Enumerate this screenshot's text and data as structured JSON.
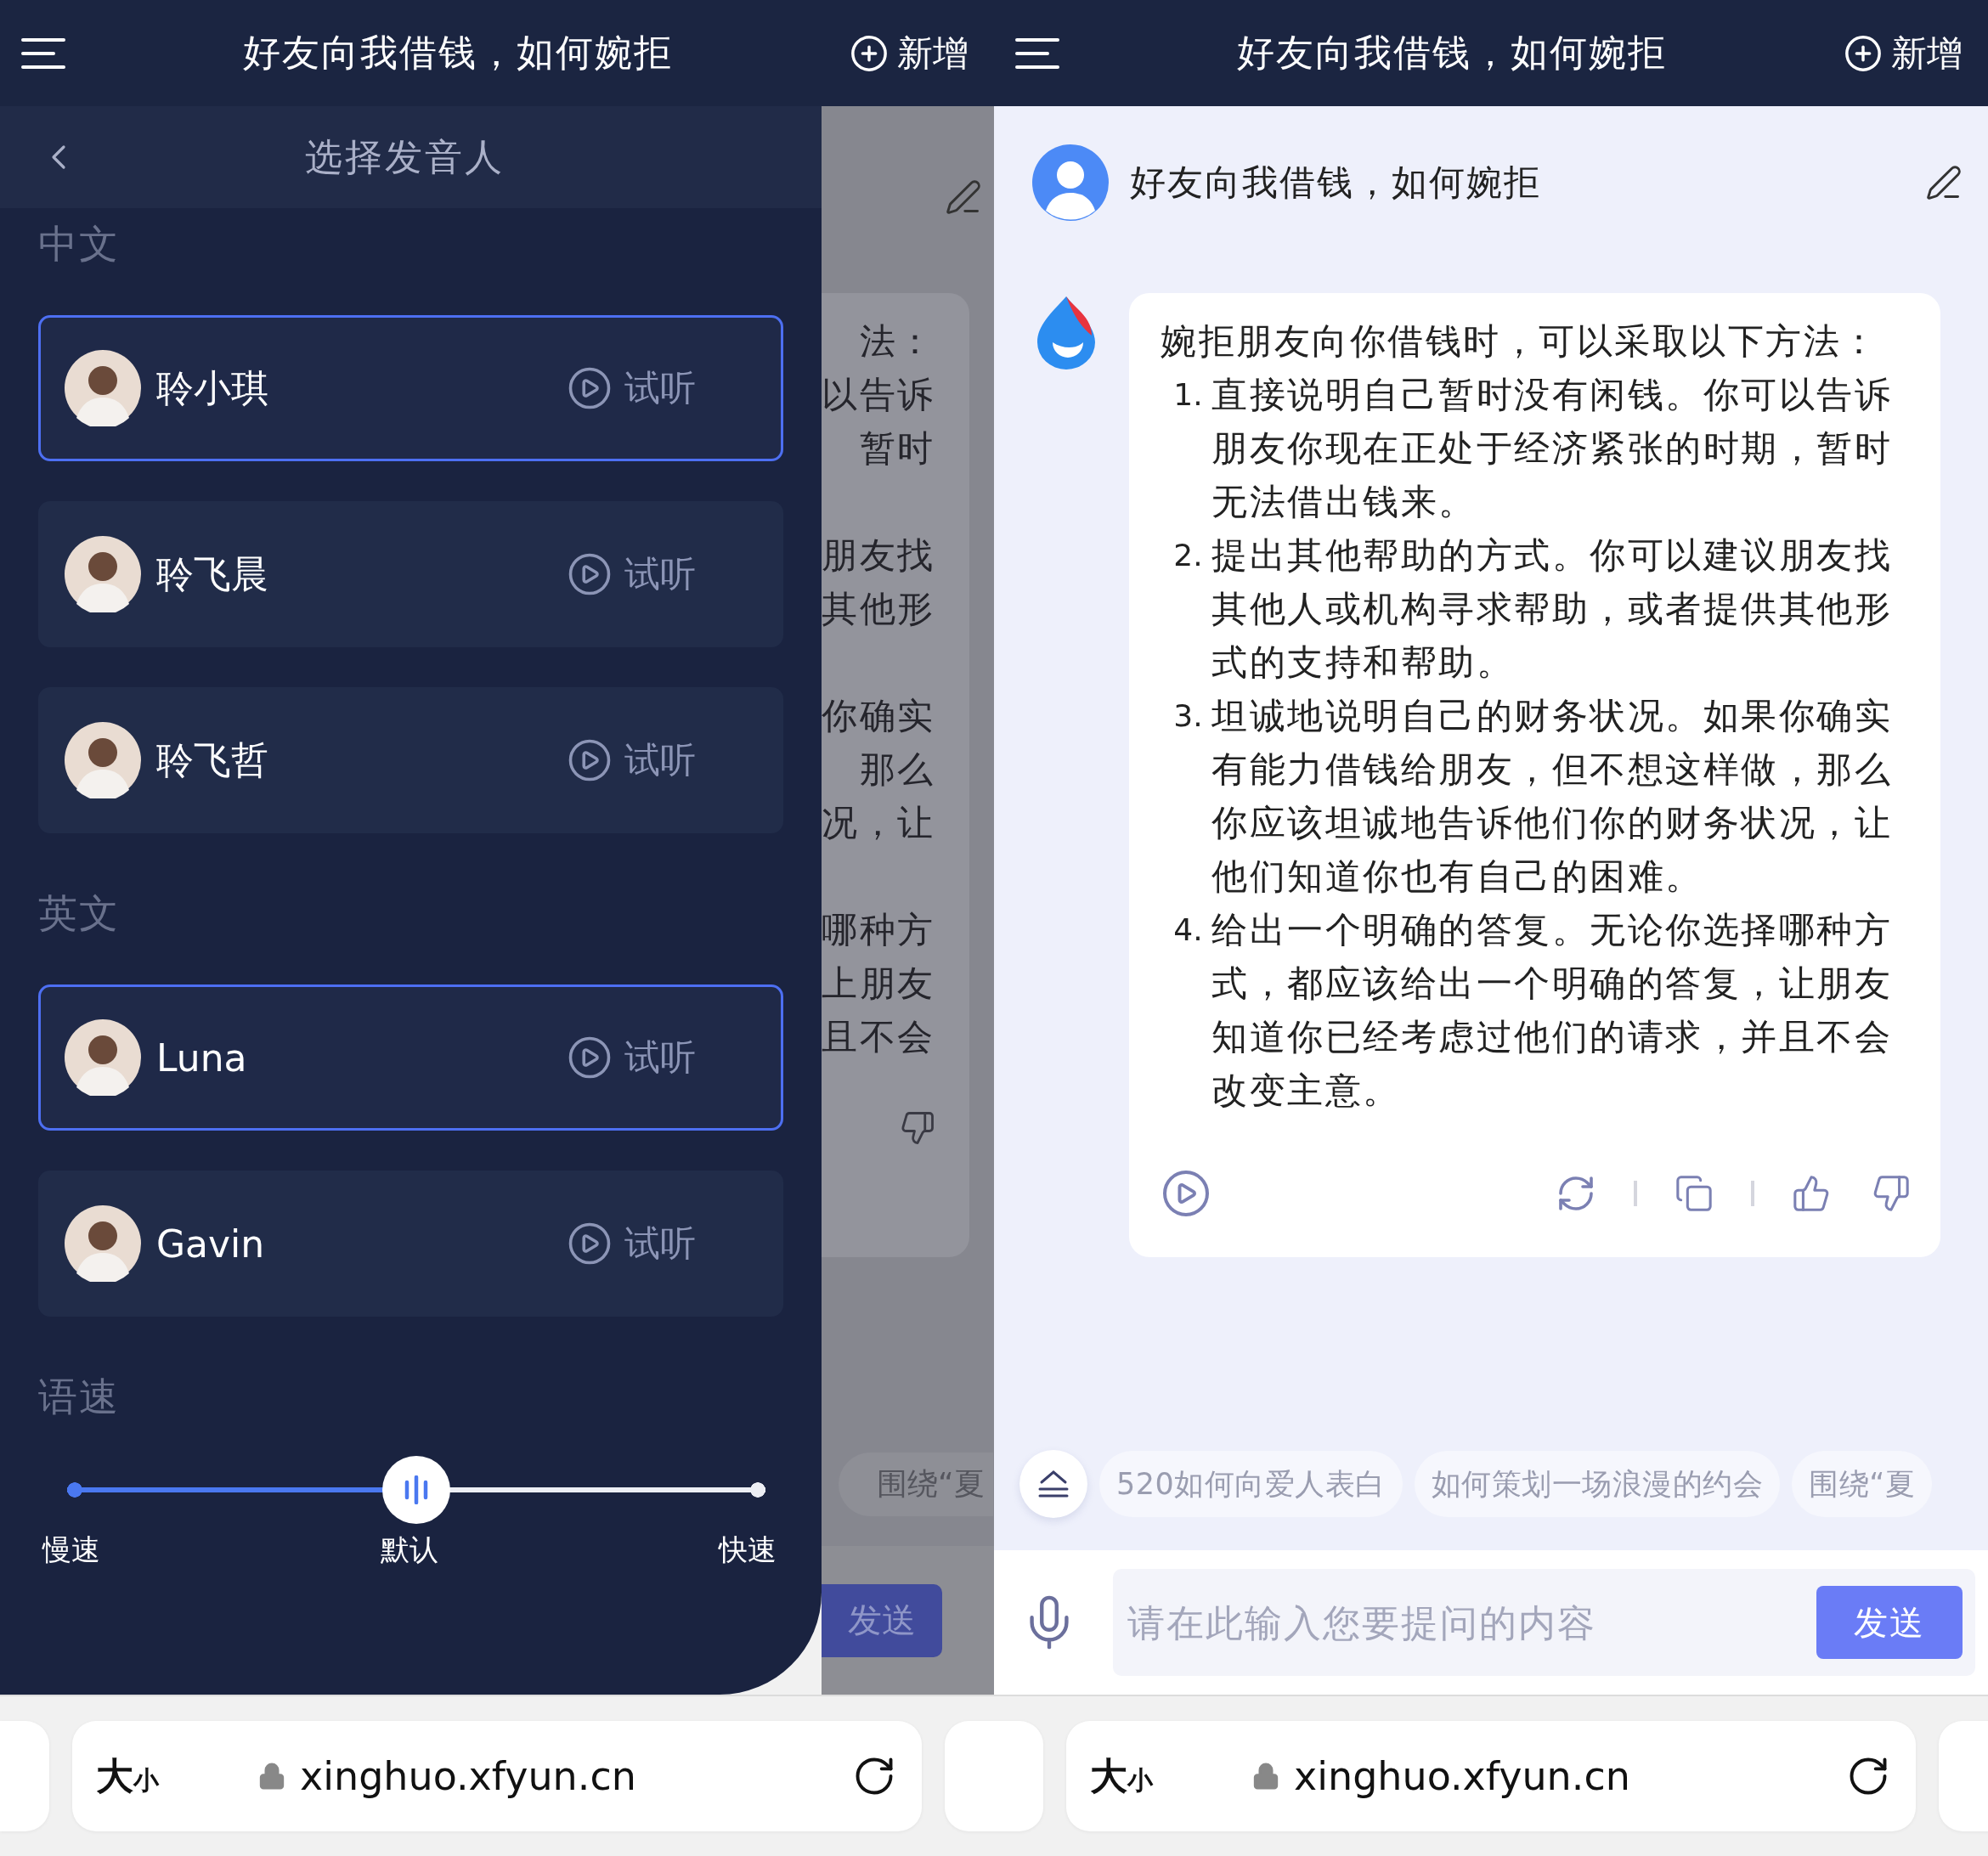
{
  "left_screen": {
    "header": {
      "title": "好友向我借钱，如何婉拒",
      "new_button": "新增"
    },
    "voice_panel": {
      "title": "选择发音人",
      "sections": [
        {
          "heading": "中文",
          "voices": [
            {
              "name": "聆小琪",
              "selected": true,
              "preview": "试听"
            },
            {
              "name": "聆飞晨",
              "selected": false,
              "preview": "试听"
            },
            {
              "name": "聆飞哲",
              "selected": false,
              "preview": "试听"
            }
          ]
        },
        {
          "heading": "英文",
          "voices": [
            {
              "name": "Luna",
              "selected": true,
              "preview": "试听"
            },
            {
              "name": "Gavin",
              "selected": false,
              "preview": "试听"
            }
          ]
        }
      ],
      "speed": {
        "heading": "语速",
        "level": 0.5,
        "labels": [
          "慢速",
          "默认",
          "快速"
        ]
      }
    },
    "background_chat": {
      "answer_fragments": [
        [
          "法：",
          "以告诉",
          "暂时"
        ],
        [
          "朋友找",
          "其他形"
        ],
        [
          "你确实",
          "那么",
          "况，让"
        ],
        [
          "哪种方",
          "上朋友",
          "且不会"
        ]
      ],
      "suggestion": "围绕“夏",
      "send_button": "发送"
    }
  },
  "right_screen": {
    "header": {
      "title": "好友向我借钱，如何婉拒",
      "new_button": "新增"
    },
    "question": "好友向我借钱，如何婉拒",
    "answer": {
      "intro": "婉拒朋友向你借钱时，可以采取以下方法：",
      "steps": [
        {
          "number": "1.",
          "text": "直接说明自己暂时没有闲钱。你可以告诉朋友你现在正处于经济紧张的时期，暂时无法借出钱来。"
        },
        {
          "number": "2.",
          "text": "提出其他帮助的方式。你可以建议朋友找其他人或机构寻求帮助，或者提供其他形式的支持和帮助。"
        },
        {
          "number": "3.",
          "text": "坦诚地说明自己的财务状况。如果你确实有能力借钱给朋友，但不想这样做，那么你应该坦诚地告诉他们你的财务状况，让他们知道你也有自己的困难。"
        },
        {
          "number": "4.",
          "text": "给出一个明确的答复。无论你选择哪种方式，都应该给出一个明确的答复，让朋友知道你已经考虑过他们的请求，并且不会改变主意。"
        }
      ]
    },
    "suggestions": [
      "520如何向爱人表白",
      "如何策划一场浪漫的约会",
      "围绕“夏"
    ],
    "input": {
      "placeholder": "请在此输入您要提问的内容"
    },
    "send_button": "发送"
  },
  "browser_bars": [
    {
      "text_size": "大$_{小}$",
      "url": "xinghuo.xfyun.cn"
    },
    {
      "text_size": "大$_{小}$",
      "url": "xinghuo.xfyun.cn"
    }
  ]
}
